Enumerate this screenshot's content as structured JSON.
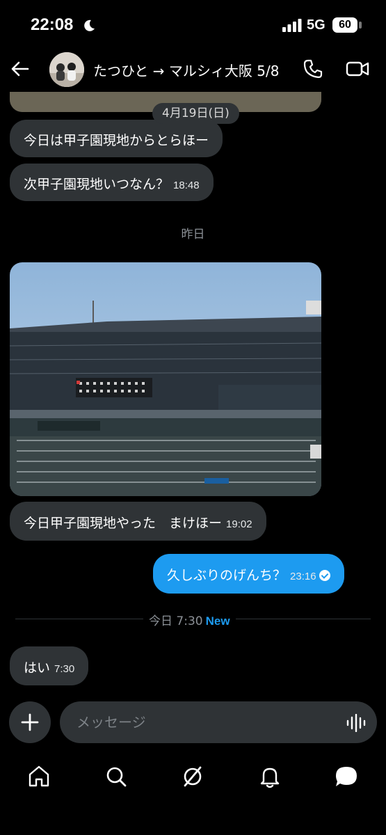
{
  "status_bar": {
    "time": "22:08",
    "network": "5G",
    "battery": "60"
  },
  "header": {
    "title": "たつひと → マルシィ大阪 5/8"
  },
  "messages": {
    "date_pill": "4月19日(日)",
    "m1": {
      "text": "今日は甲子園現地からとらほー"
    },
    "m2": {
      "text": "次甲子園現地いつなん？",
      "time": "18:48"
    },
    "yesterday": "昨日",
    "m3": {
      "text": "今日甲子園現地やった　まけほー",
      "time": "19:02"
    },
    "m4": {
      "text": "久しぶりのげんち？",
      "time": "23:16"
    },
    "today": "今日 7:30",
    "new_badge": "New",
    "m5": {
      "text": "はい",
      "time": "7:30"
    }
  },
  "composer": {
    "placeholder": "メッセージ"
  },
  "tabs": [
    "home-icon",
    "search-icon",
    "grok-icon",
    "notifications-icon",
    "messages-icon"
  ],
  "colors": {
    "accent": "#1d9bf0",
    "bubble_in": "#2f3336",
    "background": "#000000"
  }
}
